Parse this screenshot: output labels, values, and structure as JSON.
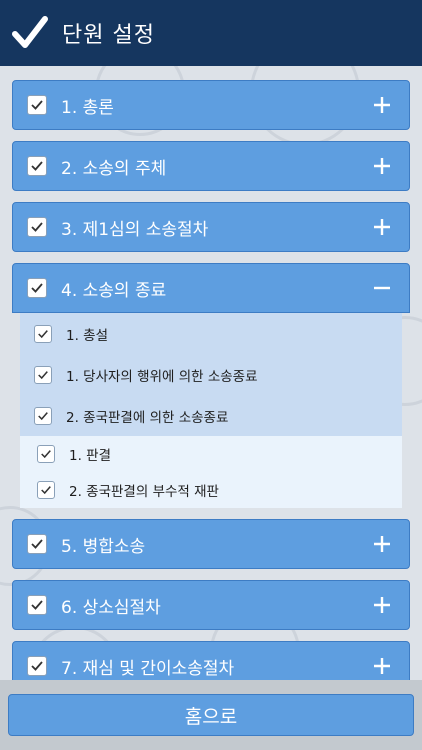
{
  "header": {
    "title": "단원 설정"
  },
  "sections": [
    {
      "label": "1. 총론",
      "toggle": "+"
    },
    {
      "label": "2. 소송의 주체",
      "toggle": "+"
    },
    {
      "label": "3. 제1심의 소송절차",
      "toggle": "+"
    },
    {
      "label": "4. 소송의 종료",
      "toggle": "−",
      "items": [
        {
          "label": "1. 총설"
        },
        {
          "label": "1. 당사자의 행위에 의한 소송종료"
        },
        {
          "label": "2. 종국판결에 의한 소송종료"
        }
      ],
      "subitems": [
        {
          "label": "1. 판결"
        },
        {
          "label": "2. 종국판결의 부수적 재판"
        }
      ]
    },
    {
      "label": "5. 병합소송",
      "toggle": "+"
    },
    {
      "label": "6. 상소심절차",
      "toggle": "+"
    },
    {
      "label": "7. 재심 및 간이소송절차",
      "toggle": "+"
    }
  ],
  "footer": {
    "home_label": "홈으로"
  },
  "colors": {
    "header": "#15365f",
    "section": "#5e9ee0",
    "sublist": "#c8dbf2",
    "subsub": "#eaf3fc"
  }
}
